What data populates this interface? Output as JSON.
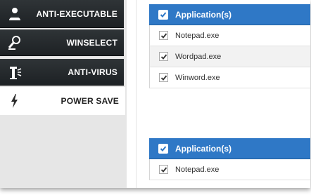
{
  "sidebar": {
    "items": [
      {
        "label": "ANTI-EXECUTABLE",
        "icon": "anti-executable-icon",
        "active": false
      },
      {
        "label": "WINSELECT",
        "icon": "winselect-icon",
        "active": false
      },
      {
        "label": "ANTI-VIRUS",
        "icon": "anti-virus-icon",
        "active": false
      },
      {
        "label": "POWER SAVE",
        "icon": "power-save-icon",
        "active": true
      }
    ]
  },
  "panels": [
    {
      "header": "Application(s)",
      "rows": [
        "Notepad.exe",
        "Wordpad.exe",
        "Winword.exe"
      ]
    },
    {
      "header": "Application(s)",
      "rows": [
        "Notepad.exe"
      ]
    }
  ],
  "colors": {
    "header_blue": "#2f78c6",
    "nav_dark": "#24292c",
    "sidebar_bg": "#e6e6e6"
  }
}
